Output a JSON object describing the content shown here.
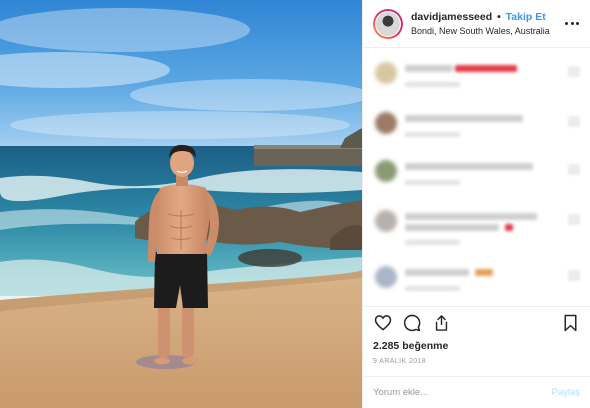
{
  "header": {
    "username": "davidjamesseed",
    "separator": "•",
    "follow_label": "Takip Et",
    "location": "Bondi, New South Wales, Australia"
  },
  "icons": {
    "more": "more-options-icon",
    "like": "heart-icon",
    "comment": "comment-icon",
    "share": "share-icon",
    "save": "bookmark-icon"
  },
  "likes_text": "2.285 beğenme",
  "date_text": "9 ARALIK 2018",
  "comment_input": {
    "placeholder": "Yorum ekle...",
    "value": ""
  },
  "post_label": "Paylaş",
  "colors": {
    "link": "#3897f0",
    "text": "#262626",
    "muted": "#999999",
    "post_button_disabled": "#b2dffc"
  }
}
